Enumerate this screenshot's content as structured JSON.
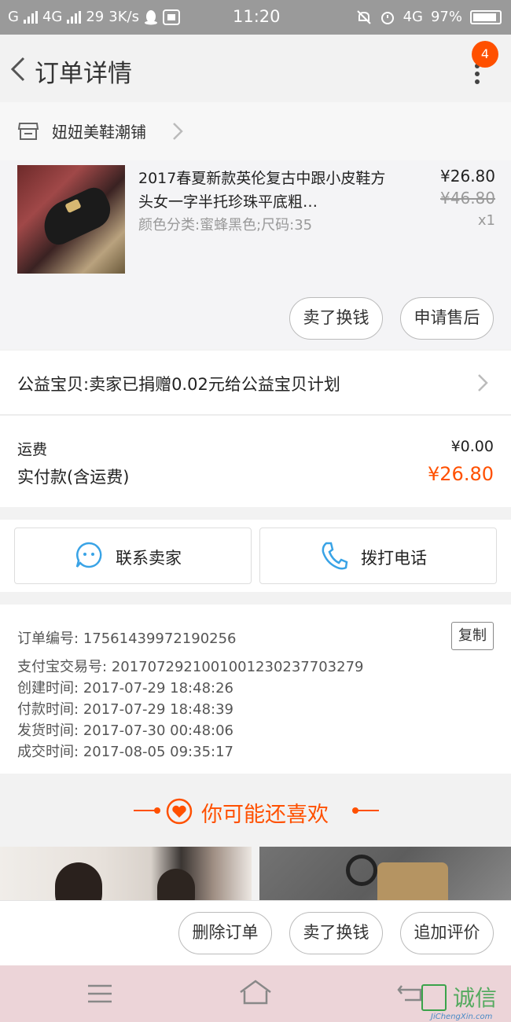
{
  "status_bar": {
    "carrier": "G",
    "network": "4G",
    "notifications": "29",
    "speed": "3K/s",
    "time": "11:20",
    "network2": "4G",
    "battery": "97%"
  },
  "nav": {
    "title": "订单详情",
    "badge": "4"
  },
  "shop": {
    "name": "妞妞美鞋潮铺"
  },
  "item": {
    "title": "2017春夏新款英伦复古中跟小皮鞋方头女一字半托珍珠平底粗…",
    "spec": "颜色分类:蜜蜂黑色;尺码:35",
    "price": "¥26.80",
    "original_price": "¥46.80",
    "quantity": "x1",
    "btn_sell": "卖了换钱",
    "btn_after_sale": "申请售后"
  },
  "charity": {
    "text": "公益宝贝:卖家已捐赠0.02元给公益宝贝计划"
  },
  "fees": {
    "shipping_label": "运费",
    "shipping_value": "¥0.00",
    "paid_label": "实付款(含运费)",
    "paid_value": "¥26.80"
  },
  "contact": {
    "seller": "联系卖家",
    "call": "拨打电话"
  },
  "order_info": {
    "order_no_label": "订单编号:",
    "order_no": "17561439972190256",
    "copy": "复制",
    "alipay_label": "支付宝交易号:",
    "alipay_no": "2017072921001001230237703279",
    "created_label": "创建时间:",
    "created": "2017-07-29  18:48:26",
    "paid_label": "付款时间:",
    "paid": "2017-07-29  18:48:39",
    "shipped_label": "发货时间:",
    "shipped": "2017-07-30  00:48:06",
    "completed_label": "成交时间:",
    "completed": "2017-08-05  09:35:17"
  },
  "recommend": {
    "title": "你可能还喜欢"
  },
  "bottom_actions": {
    "delete": "删除订单",
    "sell": "卖了换钱",
    "review": "追加评价"
  },
  "watermark": {
    "text": "诚信",
    "url": "JiChengXin.com"
  },
  "colors": {
    "accent": "#ff5000",
    "status_bar": "#9a9a9a",
    "system_nav": "#ecd4d8"
  }
}
